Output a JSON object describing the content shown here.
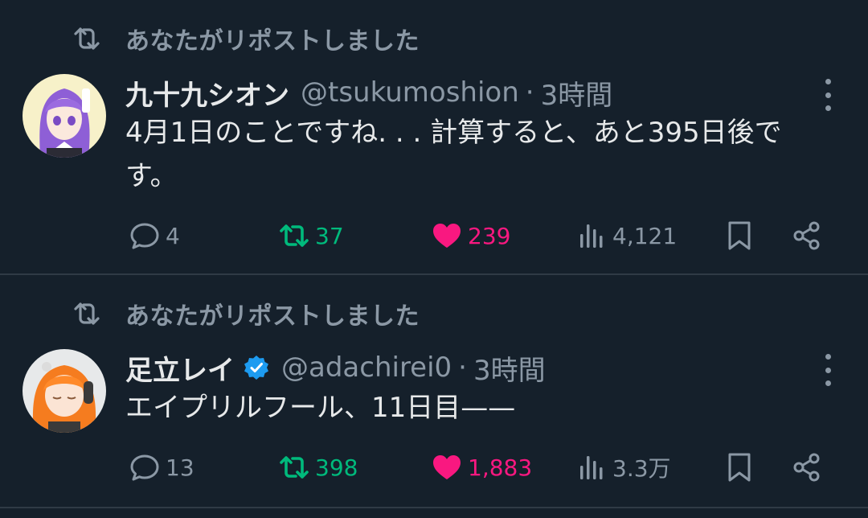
{
  "posts": [
    {
      "repost_label": "あなたがリポストしました",
      "name": "九十九シオン",
      "handle": "@tsukumoshion",
      "dot": "·",
      "time": "3時間",
      "text": "4月1日のことですね. . . 計算すると、あと395日後です。",
      "verified": false,
      "replies": "4",
      "reposts": "37",
      "likes": "239",
      "views": "4,121",
      "reposted_by_me": true,
      "liked_by_me": true
    },
    {
      "repost_label": "あなたがリポストしました",
      "name": "足立レイ",
      "handle": "@adachirei0",
      "dot": "·",
      "time": "3時間",
      "text": "エイプリルフール、11日目——",
      "verified": true,
      "replies": "13",
      "reposts": "398",
      "likes": "1,883",
      "views": "3.3万",
      "reposted_by_me": true,
      "liked_by_me": true
    }
  ],
  "colors": {
    "background": "#15202b",
    "text_primary": "#e7e9ea",
    "text_secondary": "#8b98a5",
    "repost_green": "#00ba7c",
    "like_pink": "#f91880",
    "verified_blue": "#1d9bf0"
  },
  "icons": [
    "repost-icon",
    "reply-icon",
    "like-icon",
    "views-icon",
    "bookmark-icon",
    "share-icon",
    "more-icon",
    "verified-badge-icon"
  ]
}
